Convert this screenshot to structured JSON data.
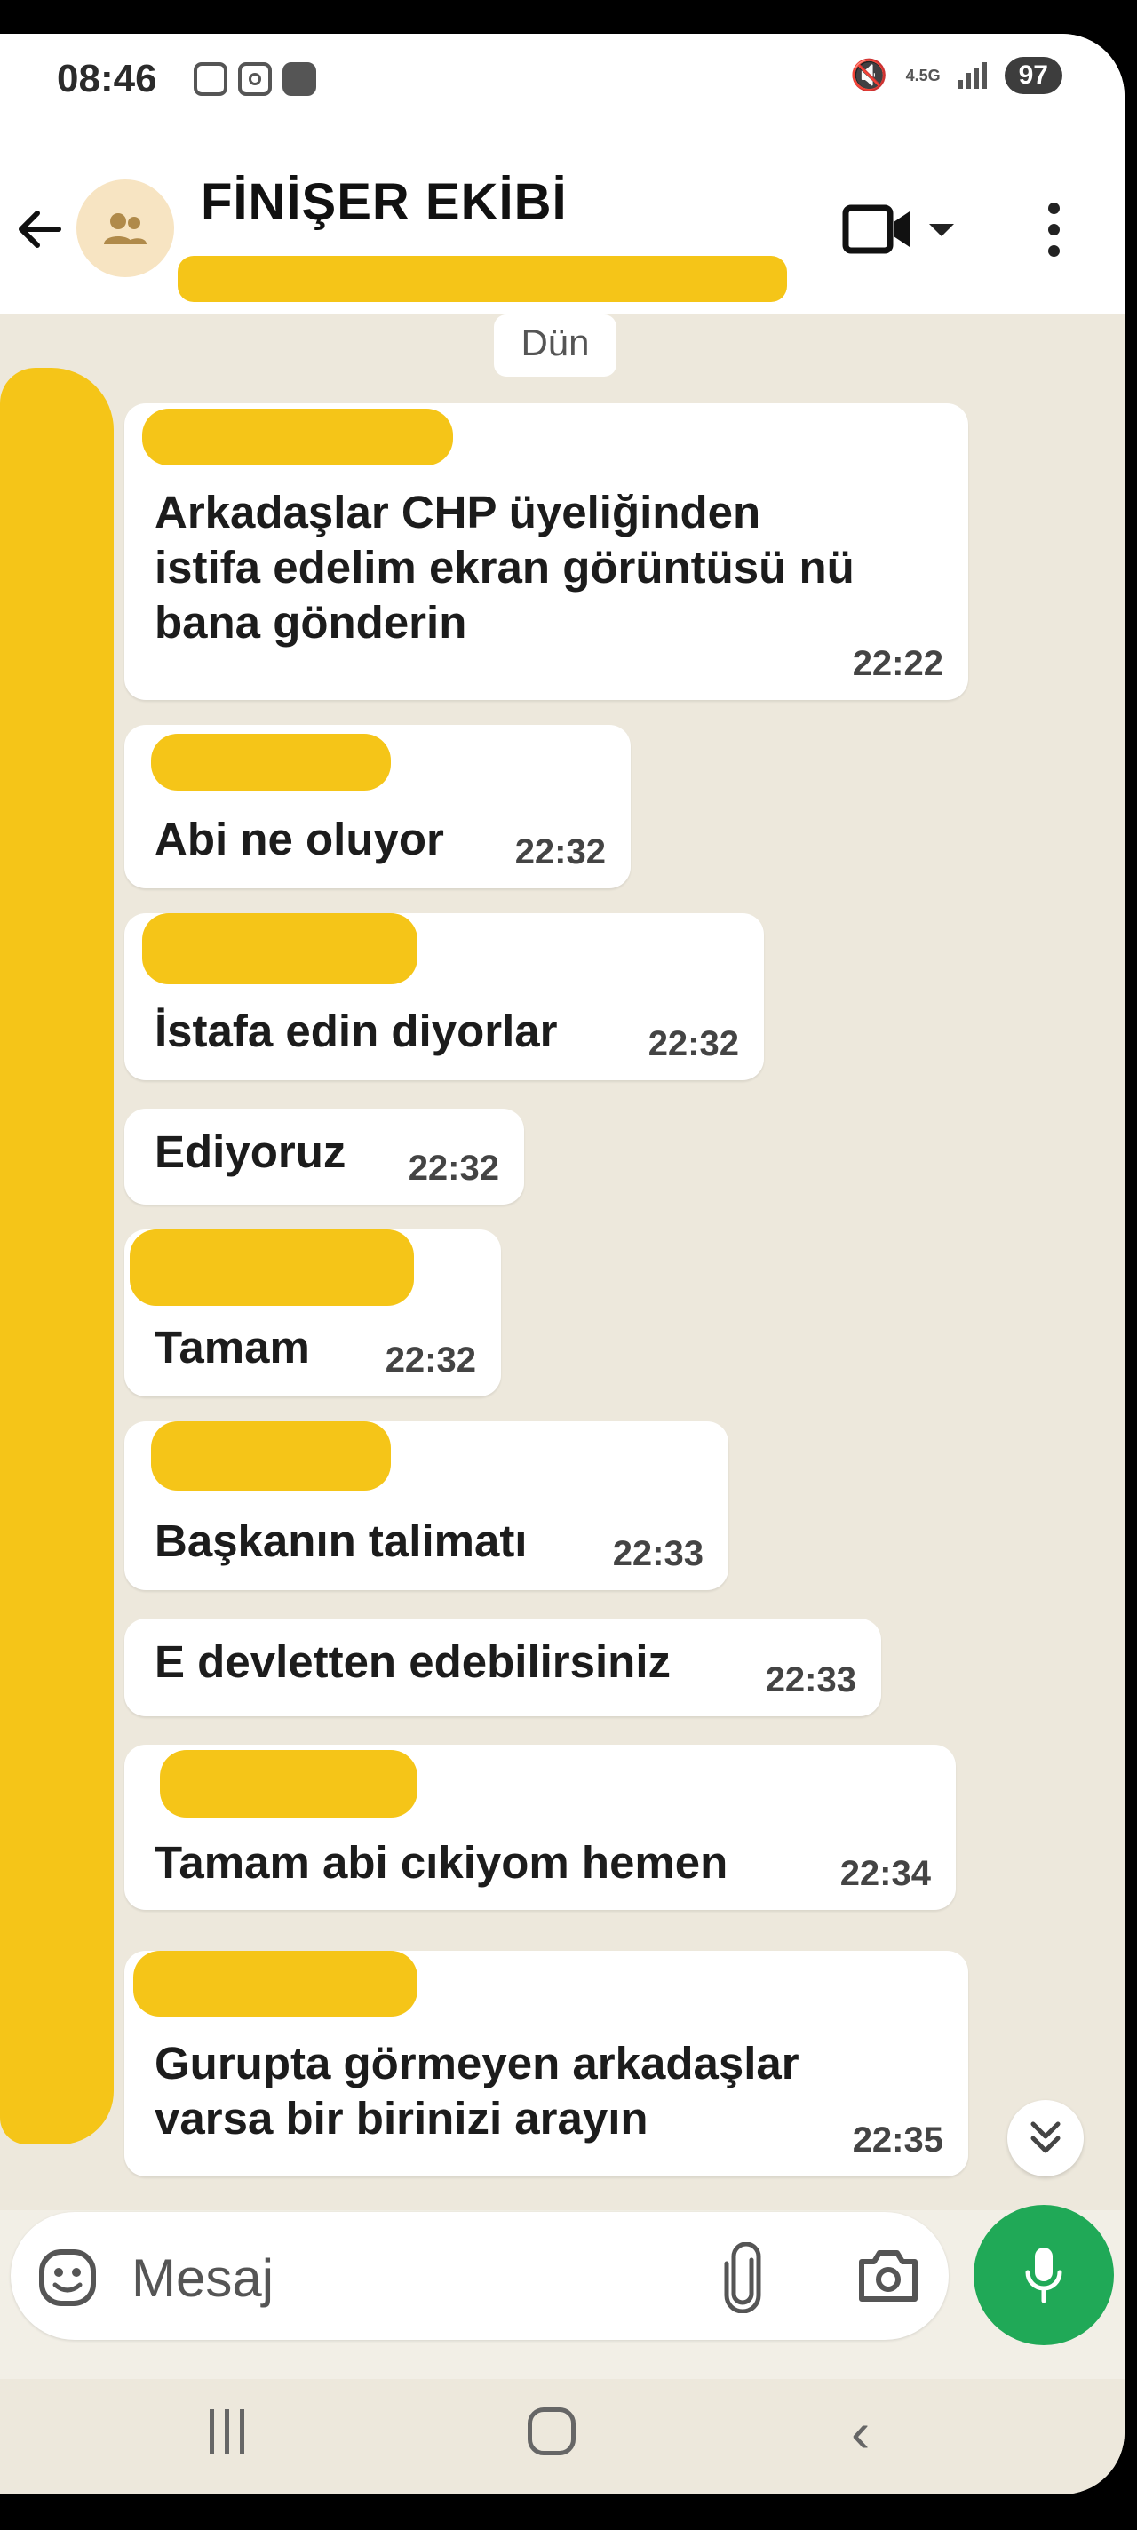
{
  "status_bar": {
    "time": "08:46",
    "network": "4.5G",
    "battery": "97"
  },
  "header": {
    "title": "FİNİŞER EKİBİ"
  },
  "chat": {
    "date_label": "Dün",
    "messages": [
      {
        "text": "Arkadaşlar CHP üyeliğinden\nistifa edelim ekran görüntüsü nü\nbana gönderin",
        "time": "22:22"
      },
      {
        "text": "Abi ne oluyor",
        "time": "22:32"
      },
      {
        "text": "İstafa edin diyorlar",
        "time": "22:32"
      },
      {
        "text": "Ediyoruz",
        "time": "22:32"
      },
      {
        "text": "Tamam",
        "time": "22:32"
      },
      {
        "text": "Başkanın talimatı",
        "time": "22:33"
      },
      {
        "text": "E devletten edebilirsiniz",
        "time": "22:33"
      },
      {
        "text": "Tamam abi cıkiyom hemen",
        "time": "22:34"
      },
      {
        "text": "Gurupta görmeyen arkadaşlar\nvarsa bir birinizi arayın",
        "time": "22:35"
      }
    ]
  },
  "input": {
    "placeholder": "Mesaj"
  },
  "colors": {
    "accent": "#20a957",
    "redaction": "#f5c518",
    "chat_bg": "#ede8dc"
  },
  "icons": [
    "back-arrow-icon",
    "group-icon",
    "video-call-icon",
    "dropdown-icon",
    "more-options-icon",
    "emoji-icon",
    "attach-icon",
    "camera-icon",
    "mic-icon",
    "scroll-down-icon"
  ]
}
